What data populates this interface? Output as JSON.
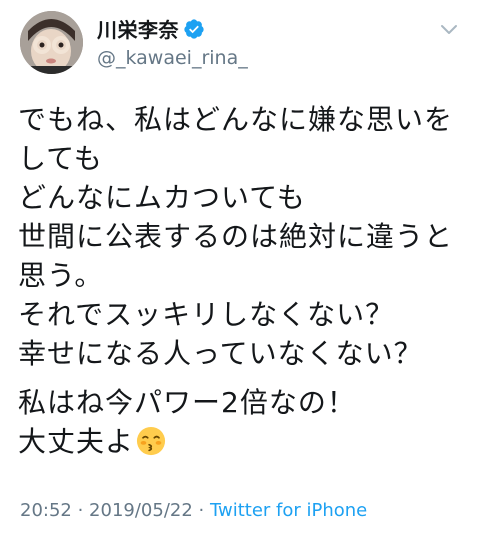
{
  "user": {
    "display_name": "川栄李奈",
    "handle": "@_kawaei_rina_",
    "verified": true,
    "avatar_icon": "avatar"
  },
  "icons": {
    "verified": "verified-badge-icon",
    "more": "chevron-down-icon",
    "emoji": "kissing-face-emoji"
  },
  "tweet": {
    "lines": [
      "でもね、私はどんなに嫌な思いを",
      "しても",
      "どんなにムカついても",
      "世間に公表するのは絶対に違うと",
      "思う。",
      "それでスッキリしなくない？",
      "幸せになる人っていなくない？",
      "私はね今パワー2倍なの！",
      "大丈夫よ"
    ]
  },
  "meta": {
    "time": "20:52",
    "separator": " · ",
    "date": "2019/05/22",
    "source": "Twitter for iPhone"
  },
  "colors": {
    "text": "#14171a",
    "secondary": "#657786",
    "accent": "#1da1f2"
  }
}
